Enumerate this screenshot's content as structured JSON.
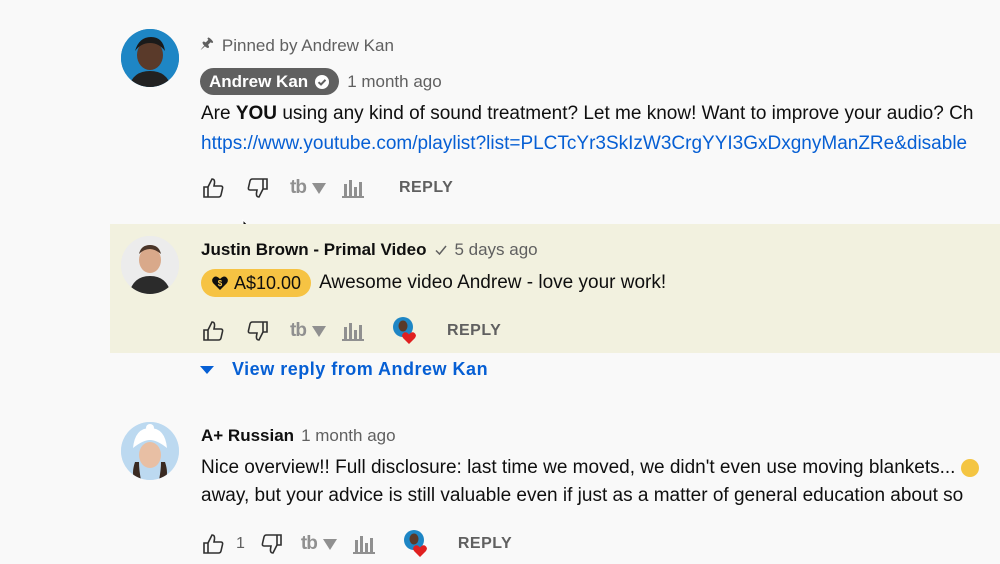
{
  "comments": [
    {
      "pinned_label": "Pinned by Andrew Kan",
      "author": "Andrew Kan",
      "time": "1 month ago",
      "text_pre": "Are ",
      "text_bold": "YOU",
      "text_post": " using any kind of sound treatment? Let me know! Want to improve your audio? Ch",
      "link": "https://www.youtube.com/playlist?list=PLCTcYr3SkIzW3CrgYYI3GxDxgnyManZRe&disable",
      "reply_label": "REPLY",
      "tb_label": "tb"
    },
    {
      "author": "Justin Brown - Primal Video",
      "time": "5 days ago",
      "super_thanks": "A$10.00",
      "text": "Awesome video Andrew - love your work!",
      "reply_label": "REPLY",
      "tb_label": "tb",
      "view_reply": "View reply from Andrew Kan"
    },
    {
      "author": "A+ Russian",
      "time": "1 month ago",
      "text_line1": "Nice overview!! Full disclosure: last time we moved, we didn't even use moving blankets...",
      "text_line2": "away, but your advice is still valuable even if just as a matter of general education about so",
      "like_count": "1",
      "reply_label": "REPLY",
      "tb_label": "tb"
    }
  ],
  "colors": {
    "highlight_bg": "#f2f1df",
    "link": "#065fd4",
    "super_thanks": "#f6c343",
    "author_chip": "#606060"
  }
}
